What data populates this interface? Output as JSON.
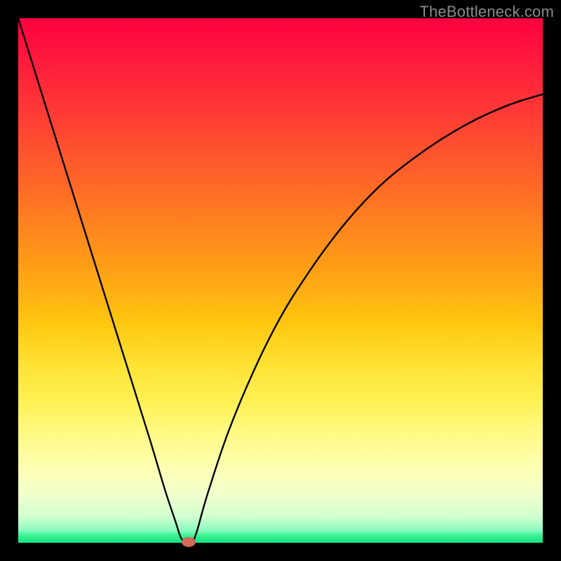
{
  "watermark": "TheBottleneck.com",
  "chart_data": {
    "type": "line",
    "title": "",
    "xlabel": "",
    "ylabel": "",
    "xlim": [
      0,
      100
    ],
    "ylim": [
      0,
      100
    ],
    "series": [
      {
        "name": "bottleneck-curve",
        "x": [
          0,
          5,
          10,
          15,
          20,
          25,
          28,
          30,
          31,
          32,
          33,
          34,
          36,
          40,
          45,
          50,
          55,
          60,
          65,
          70,
          75,
          80,
          85,
          90,
          95,
          100
        ],
        "y": [
          100,
          84,
          68,
          52,
          36,
          20,
          10,
          4,
          1,
          0,
          0,
          2,
          9,
          21,
          33,
          43,
          51,
          58,
          64,
          69,
          73,
          76.5,
          79.5,
          82,
          84,
          85.5
        ]
      }
    ],
    "marker": {
      "x": 32.5,
      "y": 0,
      "color": "#d46a5a"
    },
    "background_gradient": {
      "top": "#ff0040",
      "mid": "#ffd000",
      "bottom": "#15e57e"
    }
  }
}
